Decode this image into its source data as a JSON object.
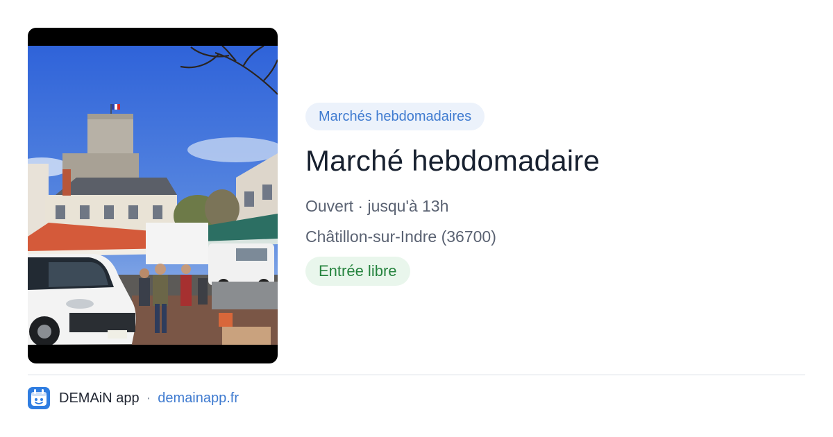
{
  "card": {
    "image_alt": "Marché sur la place au pied du donjon de Châtillon-sur-Indre",
    "category": "Marchés hebdomadaires",
    "title": "Marché hebdomadaire",
    "status": "Ouvert · jusqu'à 13h",
    "location": "Châtillon-sur-Indre (36700)",
    "access": "Entrée libre"
  },
  "footer": {
    "app_name": "DEMAiN app",
    "separator": "·",
    "domain": "demainapp.fr",
    "logo_icon": "demain-app-logo-icon"
  },
  "colors": {
    "category_text": "#3f7bd0",
    "category_bg": "#ecf2fb",
    "access_text": "#26843f",
    "access_bg": "#e9f6ec",
    "title_text": "#17202f",
    "meta_text": "#5a6272",
    "link": "#3f7bd0",
    "logo_bg": "#2f7de1"
  }
}
